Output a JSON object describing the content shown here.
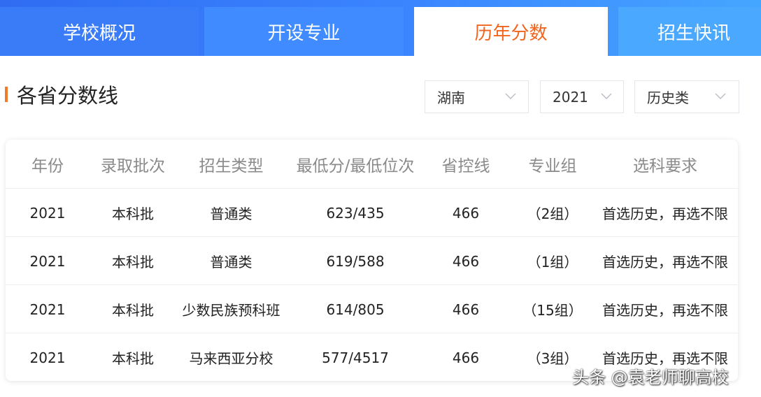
{
  "tabs": [
    {
      "label": "学校概况",
      "active": false
    },
    {
      "label": "开设专业",
      "active": false
    },
    {
      "label": "历年分数",
      "active": true
    },
    {
      "label": "招生快讯",
      "active": false
    }
  ],
  "section": {
    "title": "各省分数线"
  },
  "filters": {
    "province": "湖南",
    "year": "2021",
    "subject_type": "历史类"
  },
  "table": {
    "headers": [
      "年份",
      "录取批次",
      "招生类型",
      "最低分/最低位次",
      "省控线",
      "专业组",
      "选科要求"
    ],
    "rows": [
      [
        "2021",
        "本科批",
        "普通类",
        "623/435",
        "466",
        "（2组）",
        "首选历史，再选不限"
      ],
      [
        "2021",
        "本科批",
        "普通类",
        "619/588",
        "466",
        "（1组）",
        "首选历史，再选不限"
      ],
      [
        "2021",
        "本科批",
        "少数民族预科班",
        "614/805",
        "466",
        "（15组）",
        "首选历史，再选不限"
      ],
      [
        "2021",
        "本科批",
        "马来西亚分校",
        "577/4517",
        "466",
        "（3组）",
        "首选历史，再选不限"
      ]
    ]
  },
  "watermark": "头条 @袁老师聊高校",
  "colors": {
    "tab_blue": "#3a7bf7",
    "active_tab_text": "#f0661f",
    "section_accent": "#f27a2a"
  },
  "icons": {
    "filter_chevron": "chevron-down-icon"
  }
}
